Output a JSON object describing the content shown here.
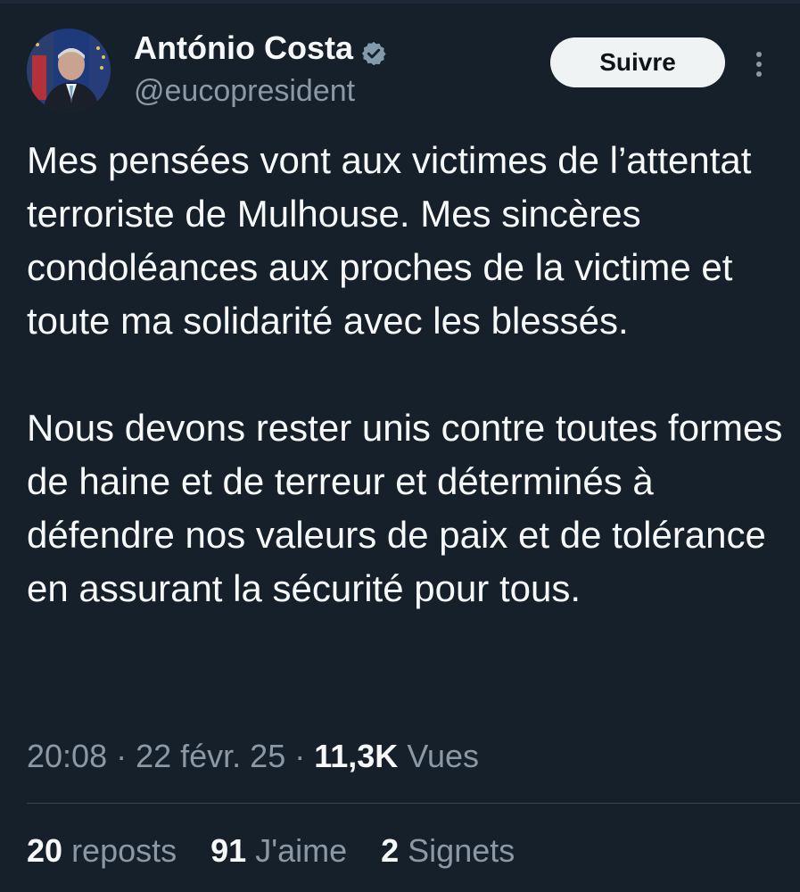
{
  "author": {
    "display_name": "António Costa",
    "handle": "@eucopresident",
    "verified_icon": "verified-badge-icon"
  },
  "actions": {
    "follow_label": "Suivre",
    "more_icon": "more-vertical-icon"
  },
  "tweet": {
    "paragraphs": [
      "Mes pensées vont aux victimes de l’attentat terroriste de Mulhouse. Mes sincères condoléances aux proches de la victime et toute ma solidarité avec les blessés.",
      "Nous devons rester unis contre toutes formes de haine et de terreur et déterminés à défendre nos valeurs de paix et de tolérance en assurant la sécurité pour tous."
    ]
  },
  "meta": {
    "time": "20:08",
    "separator": " · ",
    "date": "22 févr. 25",
    "views_count": "11,3K",
    "views_label": "Vues"
  },
  "stats": {
    "reposts_count": "20",
    "reposts_label": "reposts",
    "likes_count": "91",
    "likes_label": "J'aime",
    "bookmarks_count": "2",
    "bookmarks_label": "Signets"
  },
  "colors": {
    "background": "#15202b",
    "text": "#f7f9f9",
    "secondary_text": "#8b98a5",
    "verified": "#829aab",
    "follow_button_bg": "#eff3f4"
  }
}
